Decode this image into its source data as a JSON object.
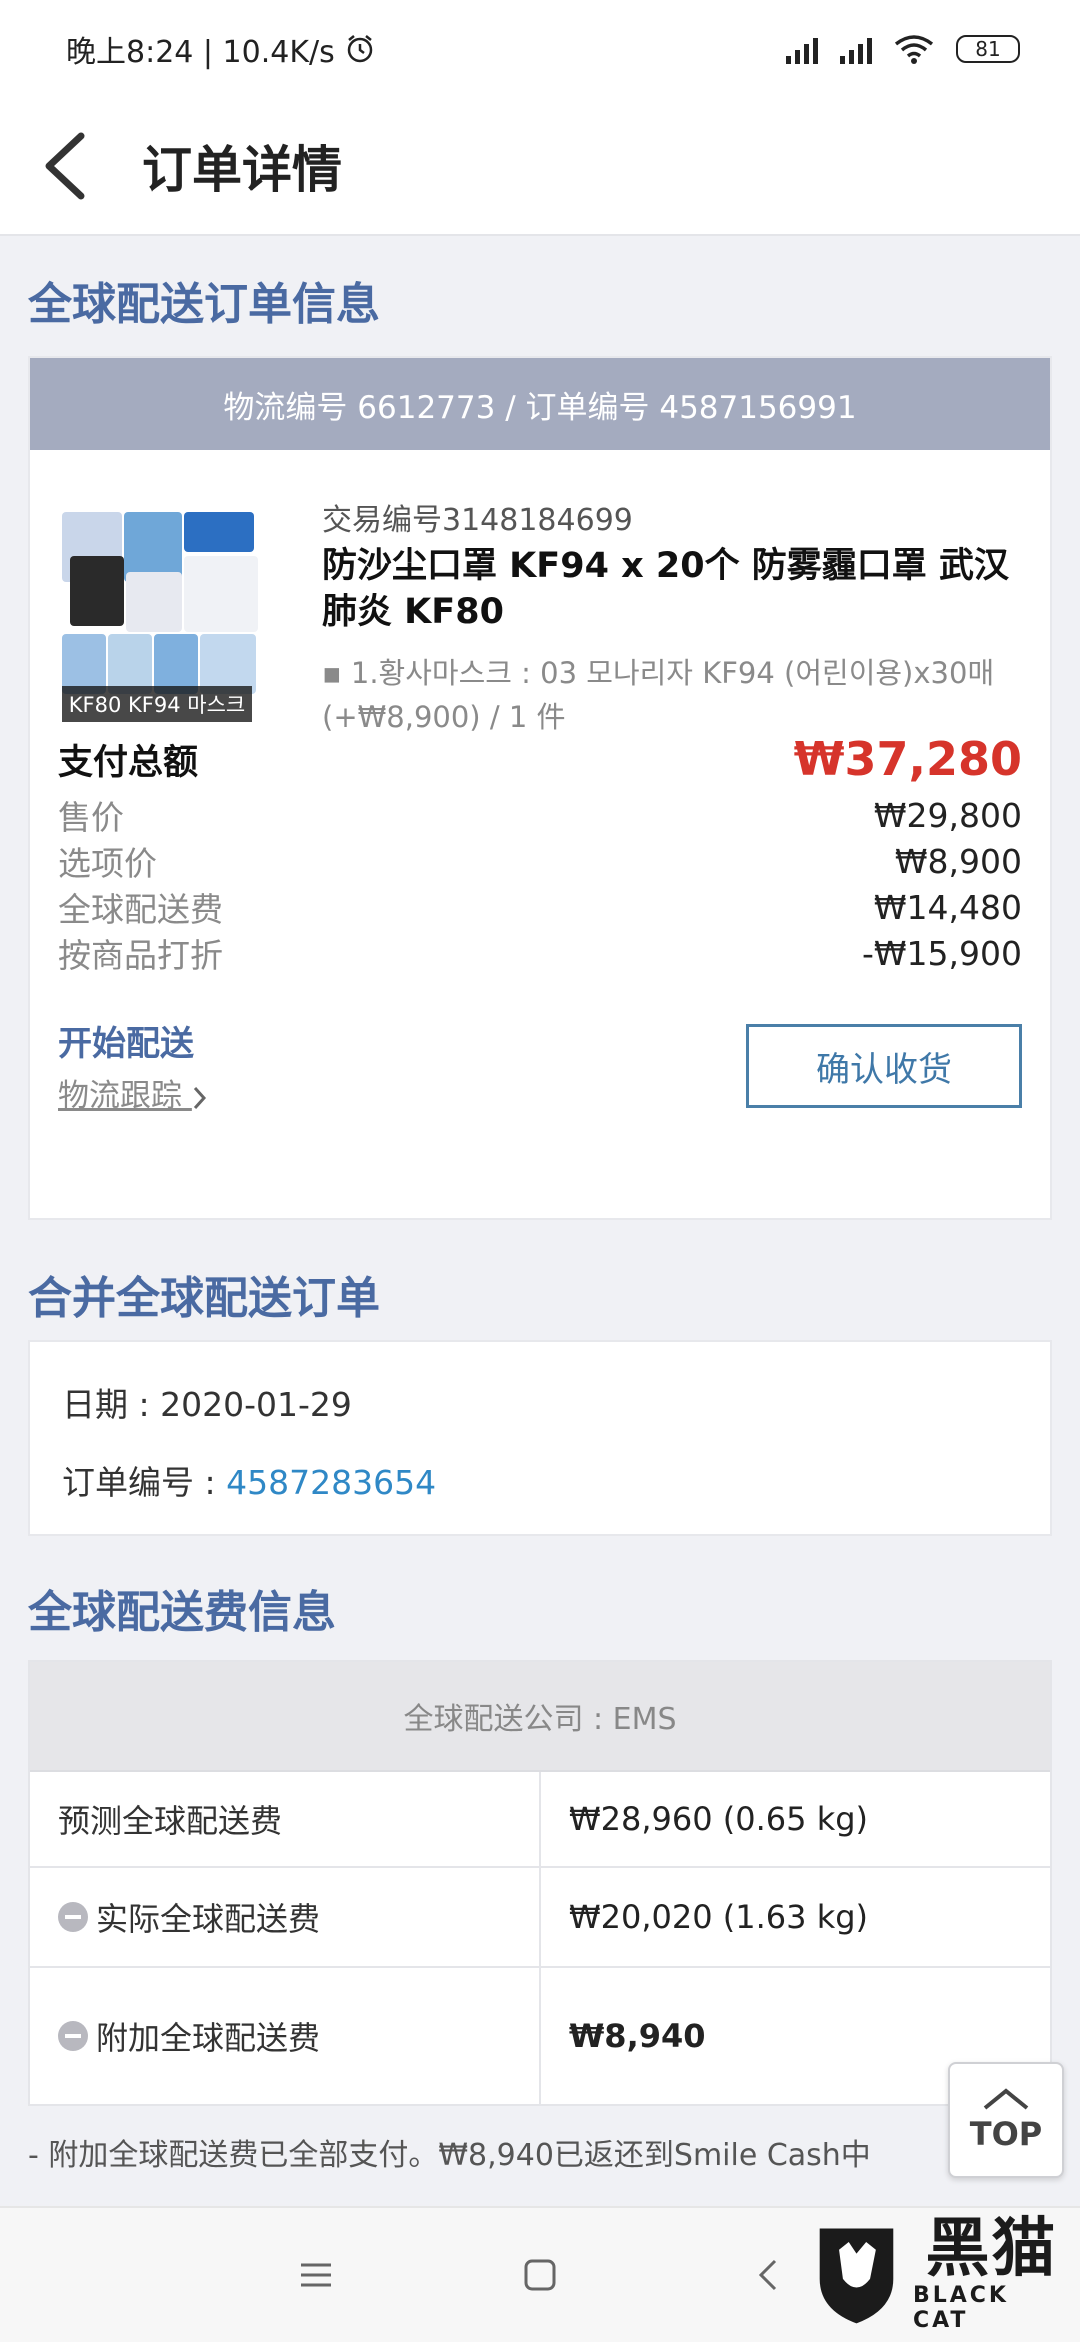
{
  "status_bar": {
    "time_speed": "晚上8:24 | 10.4K/s",
    "battery": "81"
  },
  "app_bar": {
    "title": "订单详情"
  },
  "order_section": {
    "title": "全球配送订单信息",
    "logistics_line": "物流编号 6612773 / 订单编号 4587156991",
    "trade_no": "交易编号3148184699",
    "product_name": "防沙尘口罩 KF94 x 20个 防雾霾口罩 武汉肺炎 KF80",
    "product_option": "1.황사마스크 : 03 모나리자 KF94 (어린이용)x30매 (+₩8,900) / 1 件",
    "thumb_caption": "KF80 KF94 마스크",
    "total_label": "支付总额",
    "total_value": "₩37,280",
    "lines": [
      {
        "label": "售价",
        "value": "₩29,800"
      },
      {
        "label": "选项价",
        "value": "₩8,900"
      },
      {
        "label": "全球配送费",
        "value": "₩14,480"
      },
      {
        "label": "按商品打折",
        "value": "-₩15,900"
      }
    ],
    "shipping_status": "开始配送",
    "tracking_link": "物流跟踪",
    "confirm_button": "确认收货"
  },
  "merge_section": {
    "title": "合并全球配送订单",
    "date_label": "日期 : ",
    "date_value": "2020-01-29",
    "order_label": "订单编号 : ",
    "order_value": "4587283654"
  },
  "fee_section": {
    "title": "全球配送费信息",
    "carrier": "全球配送公司 : EMS",
    "rows": [
      {
        "label": "预测全球配送费",
        "value": "₩28,960 (0.65 kg)"
      },
      {
        "label": "实际全球配送费",
        "value": "₩20,020 (1.63 kg)"
      },
      {
        "label": "附加全球配送费",
        "value": "₩8,940"
      }
    ],
    "note": "- 附加全球配送费已全部支付。₩8,940已返还到Smile Cash中"
  },
  "top_button": "TOP",
  "watermark": {
    "cn": "黑猫",
    "en": "BLACK CAT"
  },
  "colors": {
    "accent_blue": "#4a6aa2",
    "price_red": "#d6342b",
    "link_blue": "#2f88c6"
  }
}
